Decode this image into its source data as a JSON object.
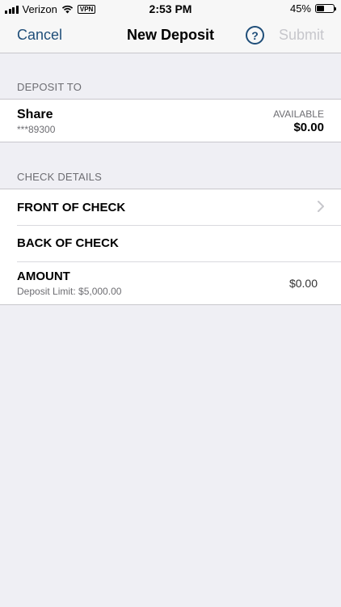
{
  "status_bar": {
    "carrier": "Verizon",
    "vpn": "VPN",
    "time": "2:53 PM",
    "battery_percent": "45%",
    "battery_level": 0.45
  },
  "nav": {
    "cancel_label": "Cancel",
    "title": "New Deposit",
    "help_glyph": "?",
    "submit_label": "Submit",
    "accent_color": "#1f4e79",
    "disabled_color": "#c7c7cc"
  },
  "deposit_to": {
    "header": "DEPOSIT TO",
    "account_name": "Share",
    "account_number": "***89300",
    "available_label": "AVAILABLE",
    "available_amount": "$0.00"
  },
  "check_details": {
    "header": "CHECK DETAILS",
    "front_label": "FRONT OF CHECK",
    "back_label": "BACK OF CHECK",
    "amount_label": "AMOUNT",
    "deposit_limit": "Deposit Limit: $5,000.00",
    "amount_value": "$0.00"
  },
  "icons": [
    "signal-icon",
    "wifi-icon",
    "battery-icon",
    "help-icon",
    "chevron-right-icon"
  ]
}
